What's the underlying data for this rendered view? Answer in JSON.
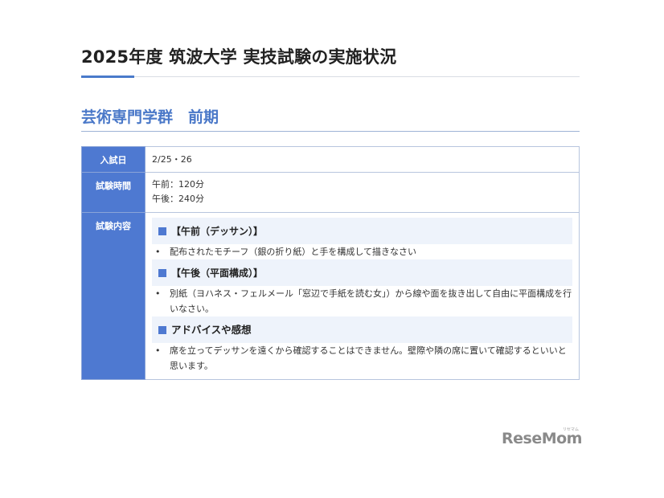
{
  "header": {
    "title": "2025年度 筑波大学 実技試験の実施状況"
  },
  "section": {
    "title": "芸術専門学群　前期"
  },
  "table": {
    "rows": [
      {
        "label": "入試日",
        "lines": [
          "2/25・26"
        ]
      },
      {
        "label": "試験時間",
        "lines": [
          "午前：120分",
          "午後：240分"
        ]
      },
      {
        "label": "試験内容"
      }
    ],
    "content": [
      {
        "heading": "【午前（デッサン）】",
        "bullets": [
          "配布されたモチーフ（銀の折り紙）と手を構成して描きなさい"
        ]
      },
      {
        "heading": "【午後（平面構成）】",
        "bullets": [
          "別紙（ヨハネス・フェルメール「窓辺で手紙を読む女」）から線や面を抜き出して自由に平面構成を行いなさい。"
        ]
      },
      {
        "heading": "アドバイスや感想",
        "bullets": [
          "席を立ってデッサンを遠くから確認することはできません。壁際や隣の席に置いて確認するといいと思います。"
        ]
      }
    ]
  },
  "watermark": {
    "logo": "ReseMom",
    "kana": "リセマム"
  },
  "colors": {
    "accent": "#4e79d1",
    "section_title": "#4a78c8",
    "subhead_bg": "#eef3fb"
  }
}
